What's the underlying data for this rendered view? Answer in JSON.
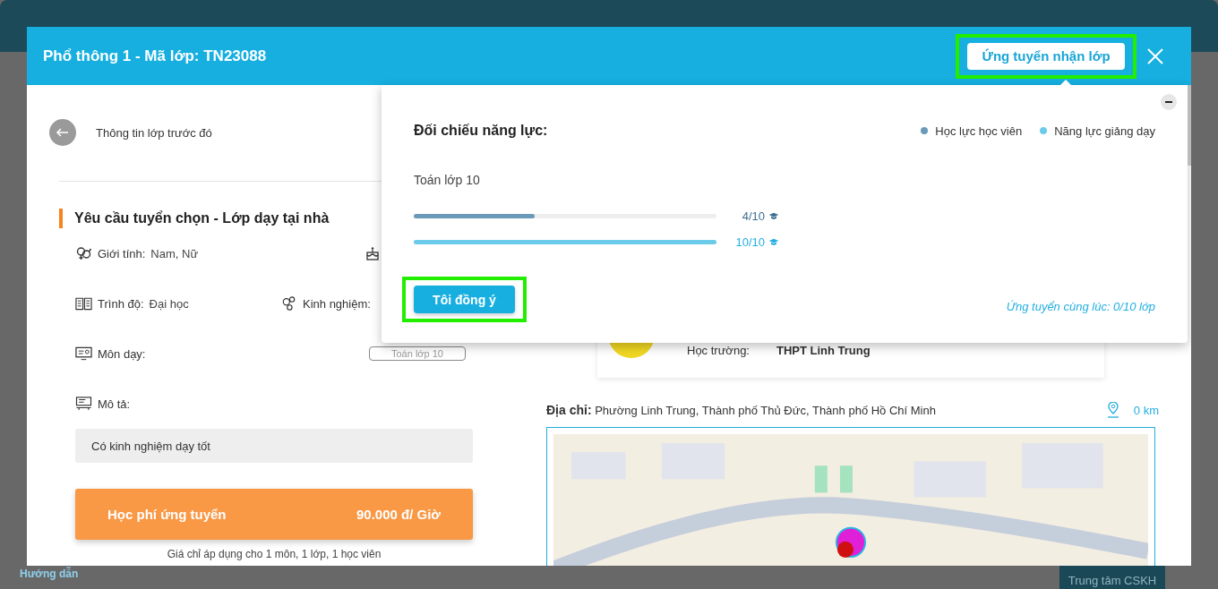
{
  "background": {
    "help_link": "Hướng dẫn",
    "support_button": "Trung tâm CSKH"
  },
  "modal": {
    "title": "Phổ thông 1 - Mã lớp: TN23088",
    "apply_button": {
      "label": "Ứng tuyển nhận lớp",
      "highlighted": true
    },
    "back_link": "Thông tin lớp trước đó",
    "section_title": "Yêu cầu tuyển chọn - Lớp dạy tại nhà",
    "field_rows": [
      [
        {
          "kind": "gender",
          "label": "Giới tính:",
          "value": "Nam, Nữ"
        },
        {
          "kind": "age"
        }
      ],
      [
        {
          "kind": "degree",
          "label": "Trình độ:",
          "value": "Đại học"
        },
        {
          "kind": "experience",
          "label": "Kinh nghiệm:"
        }
      ],
      [
        {
          "kind": "subject",
          "label": "Môn dạy:",
          "tag": "Toán lớp 10"
        }
      ],
      [
        {
          "kind": "description",
          "label": "Mô tả:"
        }
      ]
    ],
    "description": "Có kinh nghiệm dạy tốt",
    "fee": {
      "label": "Học phí ứng tuyển",
      "value": "90.000 đ/ Giờ"
    },
    "fee_note": "Giá chỉ áp dụng cho 1 môn, 1 lớp, 1 học viên",
    "student_card": {
      "label": "Học trường:",
      "value": "THPT Linh Trung"
    },
    "address": {
      "label": "Địa chỉ:",
      "value": "Phường Linh Trung, Thành phố Thủ Đức, Thành phố Hồ Chí Minh",
      "distance": "0 km"
    }
  },
  "popover": {
    "title": "Đối chiếu năng lực:",
    "legend": [
      {
        "label": "Học lực học viên",
        "color": "#6a9ab8"
      },
      {
        "label": "Năng lực giảng dạy",
        "color": "#6ccbe8"
      }
    ],
    "subject": "Toán lớp 10",
    "bars": [
      {
        "level": 0.4,
        "reading": "4/10",
        "color": "#6a9ab8"
      },
      {
        "level": 1,
        "reading": "10/10",
        "color": "#6ccbe8"
      }
    ],
    "agree_button": {
      "label": "Tôi đồng ý",
      "highlighted": true
    },
    "footer_link": "Ứng tuyển cùng lúc: 0/10 lớp"
  }
}
